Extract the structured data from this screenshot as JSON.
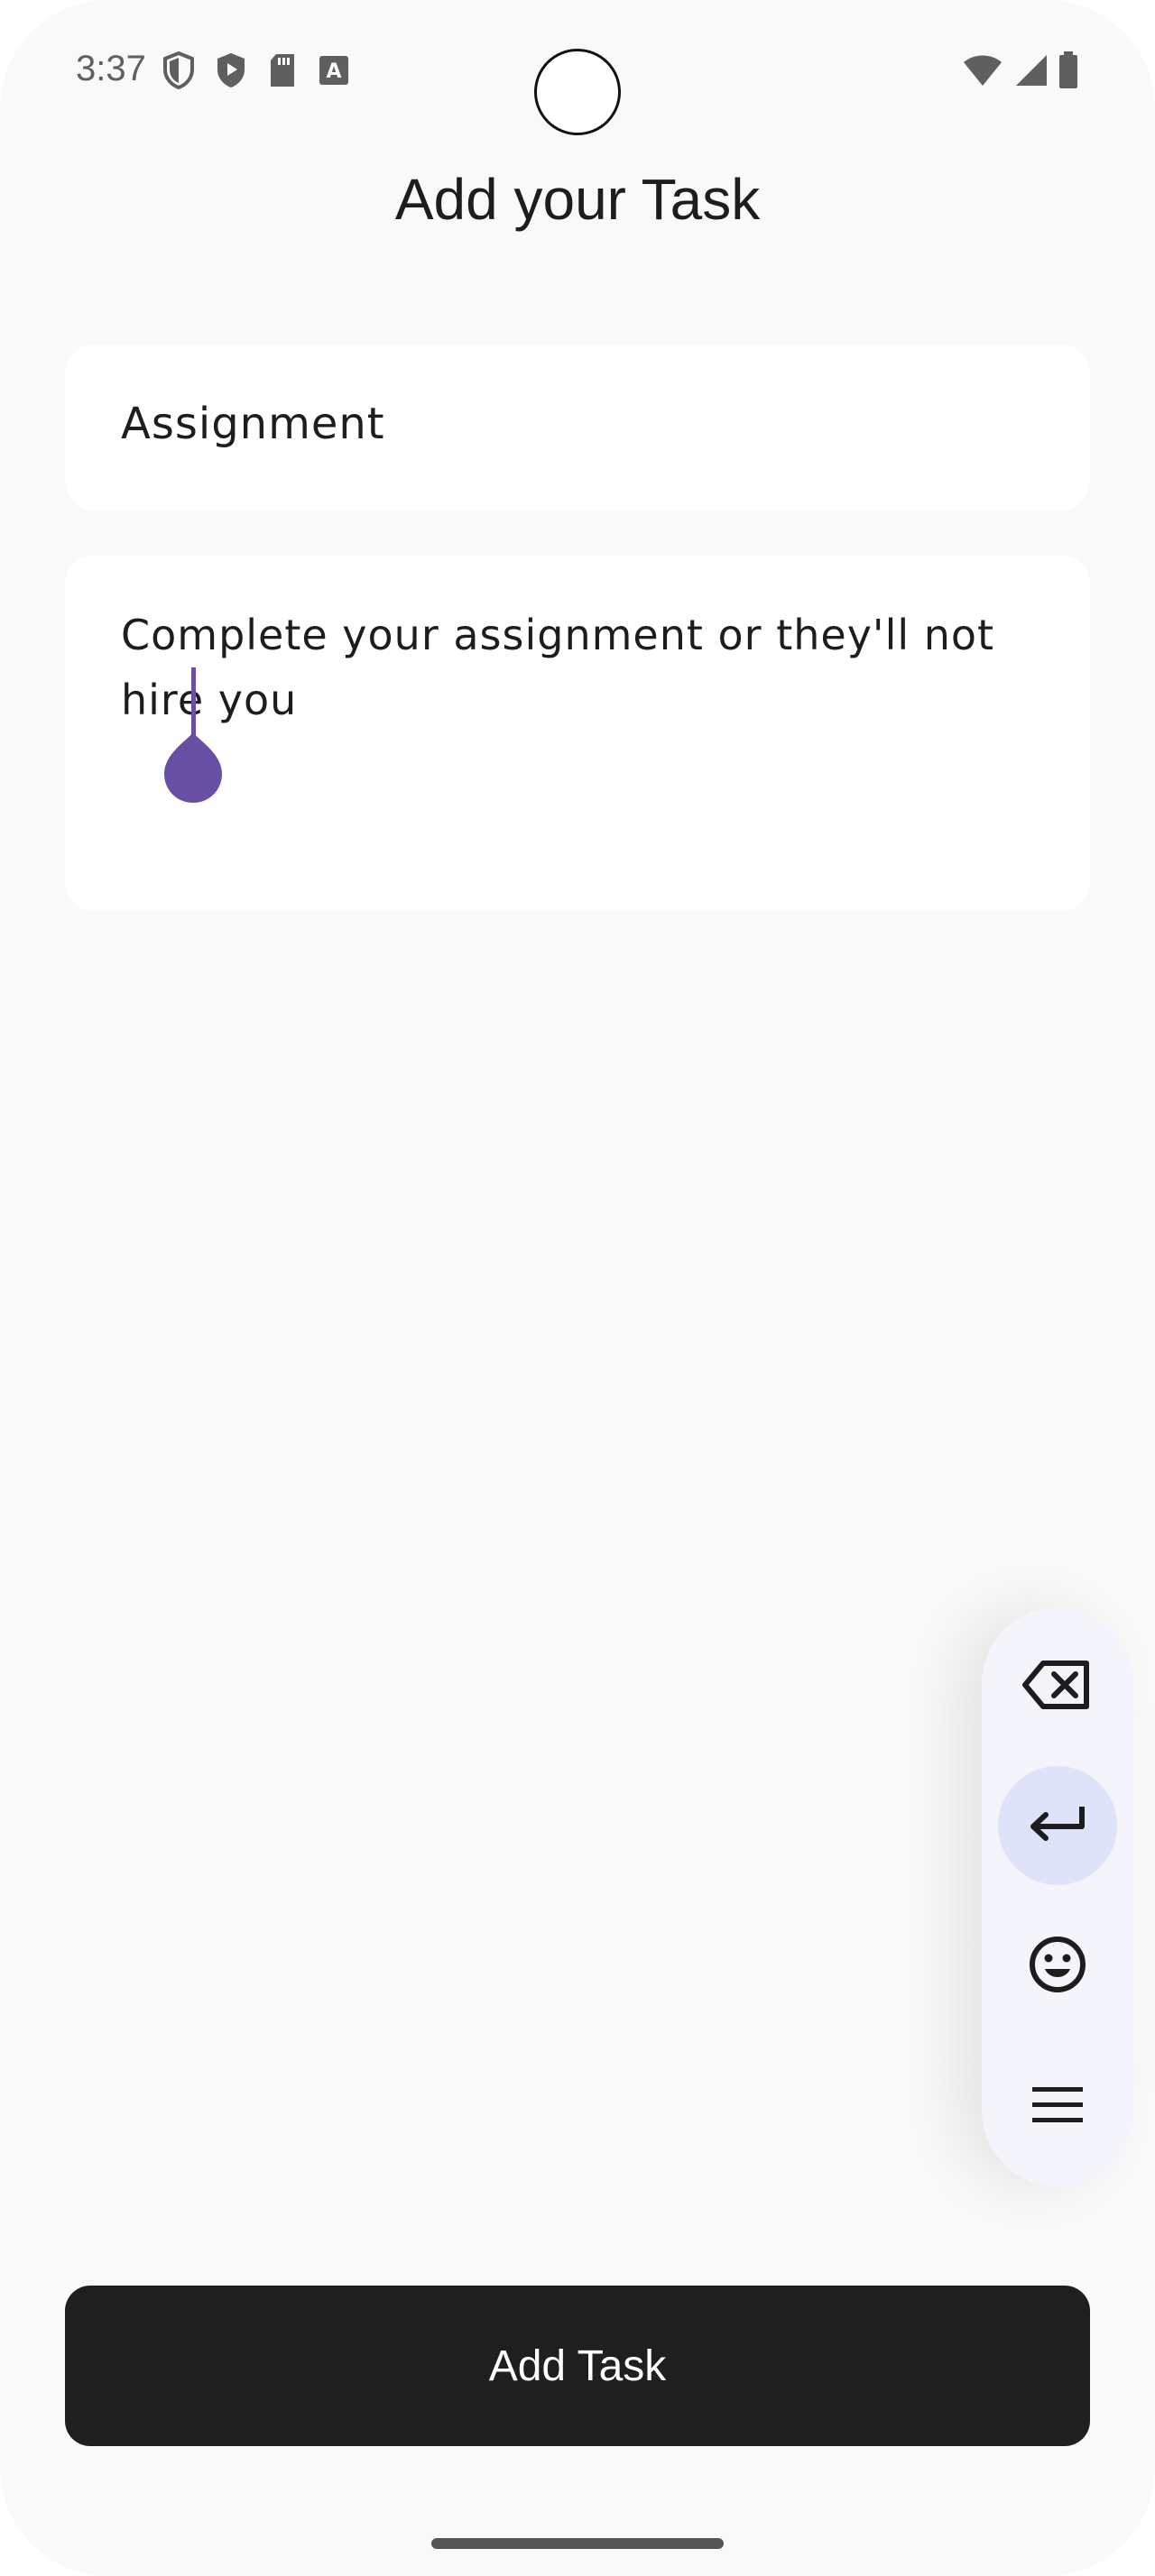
{
  "status_bar": {
    "time": "3:37",
    "left_icons": [
      "shield-icon",
      "play-protect-icon",
      "sd-card-icon",
      "font-a-icon"
    ],
    "right_icons": [
      "wifi-icon",
      "signal-icon",
      "battery-icon"
    ]
  },
  "page": {
    "title": "Add your Task"
  },
  "form": {
    "title_value": "Assignment",
    "description_value": "Complete your assignment or they'll not hire you"
  },
  "keyboard_toolbar": {
    "icons": [
      "backspace-icon",
      "enter-icon",
      "emoji-icon",
      "menu-icon"
    ]
  },
  "actions": {
    "add_label": "Add Task"
  },
  "colors": {
    "background": "#f9f9f9",
    "card": "#ffffff",
    "button": "#1f1f1f",
    "cursor_accent": "#6750a4",
    "toolbar_active": "#dfe3fa"
  }
}
